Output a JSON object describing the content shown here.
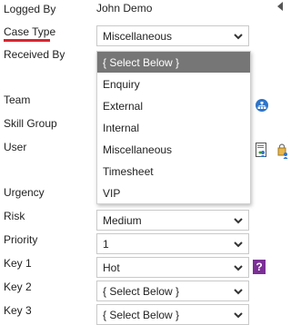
{
  "form": {
    "logged_by": {
      "label": "Logged By",
      "value": "John Demo"
    },
    "case_type": {
      "label": "Case Type",
      "value": "Miscellaneous"
    },
    "received_by": {
      "label": "Received By"
    },
    "team": {
      "label": "Team"
    },
    "skill_group": {
      "label": "Skill Group"
    },
    "user": {
      "label": "User"
    },
    "urgency": {
      "label": "Urgency"
    },
    "risk": {
      "label": "Risk",
      "value": "Medium"
    },
    "priority": {
      "label": "Priority",
      "value": "1"
    },
    "key1": {
      "label": "Key 1",
      "value": "Hot",
      "help_text": "?"
    },
    "key2": {
      "label": "Key 2",
      "value": "{ Select Below }"
    },
    "key3": {
      "label": "Key 3",
      "value": "{ Select Below }"
    }
  },
  "dropdown": {
    "options": [
      "{ Select Below }",
      "Enquiry",
      "External",
      "Internal",
      "Miscellaneous",
      "Timesheet",
      "VIP"
    ],
    "highlighted_index": 0
  },
  "icons": {
    "collapse": "triangle-left-icon",
    "team_lookup": "team-org-icon",
    "user_lookup": "user-card-icon",
    "user_lock": "user-lock-icon",
    "help": "help-icon",
    "chevron": "chevron-down-icon"
  },
  "colors": {
    "active_underline": "#d8262f",
    "dropdown_highlight": "#767676",
    "team_icon": "#2e74c8",
    "help_icon": "#7b2f96"
  }
}
